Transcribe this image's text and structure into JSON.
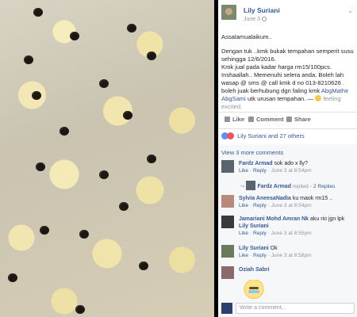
{
  "post": {
    "author": "Lily Suriani",
    "date": "June 3",
    "text1": "Assalamualaikum..",
    "text2": "Dengan tuk ..kmk bukak tempahan semperit susu sehingga 12/6/2016.",
    "text3": "Kmk jual pada kadar harga rm15/100pcs.",
    "text4": "Inshaallah.. Memenuhi selera anda. Boleh lah wasap @ sms @ call kmk d no 013-8210626 . boleh juak berhubung dgn faling kmk ",
    "tag": "AbgMathir AbgSami",
    "text5": " utk urusan tempahan.",
    "feeling": "feeling excited.",
    "actions": {
      "like": "Like",
      "comment": "Comment",
      "share": "Share"
    },
    "likes_text": "Lily Suriani and 27 others"
  },
  "comments": {
    "view_more": "View 3 more comments",
    "items": [
      {
        "name": "Fardz Armad",
        "text": "sok ado x lly?",
        "meta_like": "Like",
        "meta_reply": "Reply",
        "time": "June 3 at 8:54pm"
      },
      {
        "name": "Fardz Armad",
        "text": "replied",
        "replies": "2 Replies"
      },
      {
        "name": "Sylvia AneesaNadia",
        "text": "ku maok rm15 ..",
        "meta_like": "Like",
        "meta_reply": "Reply",
        "time": "June 3 at 8:54pm"
      },
      {
        "name": "Jamariani Mohd Amran Nk",
        "text": "aku rio jgn lpk",
        "tag": "Lily Suriani",
        "meta_like": "Like",
        "meta_reply": "Reply",
        "time": "June 3 at 8:55pm"
      },
      {
        "name": "Lily Suriani",
        "text": "Ok",
        "meta_like": "Like",
        "meta_reply": "Reply",
        "time": "June 3 at 8:58pm"
      },
      {
        "name": "Oziah Sabri"
      }
    ],
    "write_placeholder": "Write a comment..."
  }
}
